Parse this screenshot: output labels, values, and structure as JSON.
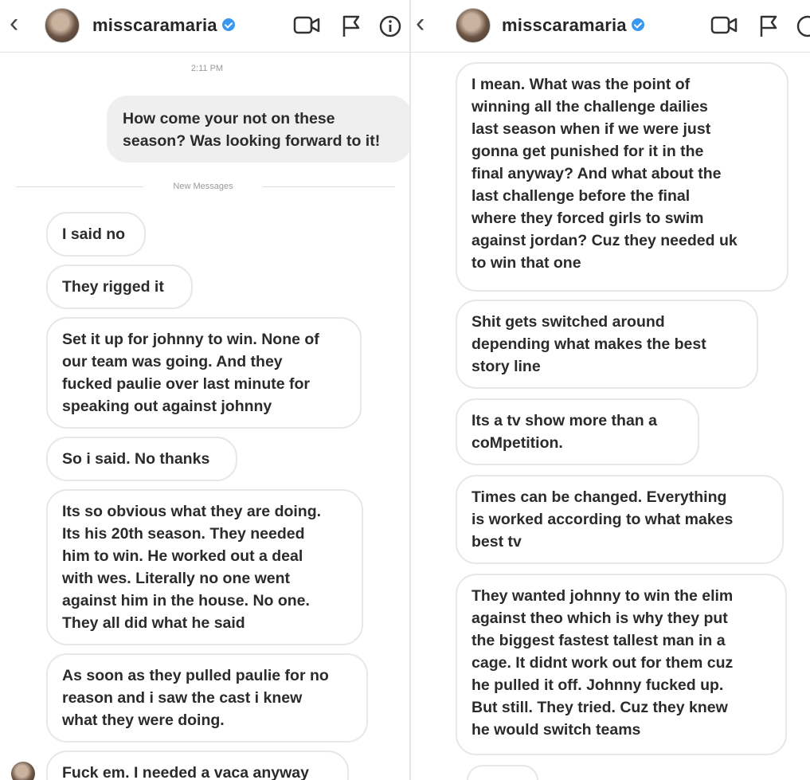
{
  "left": {
    "header": {
      "username": "misscaramaria"
    },
    "timestamp": "2:11 PM",
    "new_messages_label": "New Messages",
    "sent_message": "How come your not on these\nseason? Was looking forward to it!",
    "messages": [
      "I said no",
      "They rigged it",
      "Set it up for johnny to win. None of\nour team was going. And they\nfucked paulie over last minute for\nspeaking out against johnny",
      "So i said. No thanks",
      "Its so obvious what they are doing.\nIts his 20th season. They needed\nhim to win. He worked out a deal\nwith wes. Literally no one went\nagainst him in the house. No one.\nThey all did what he said",
      "As soon as they pulled paulie for no\nreason and i saw the cast i knew\nwhat they were doing.",
      "Fuck em. I needed a vaca anyway"
    ]
  },
  "right": {
    "header": {
      "username": "misscaramaria"
    },
    "messages": [
      "I mean. What was the point of\nwinning all the challenge dailies\nlast season when if we were just\ngonna get punished for it in the\nfinal anyway? And what about the\nlast challenge before the final\nwhere they forced girls to swim\nagainst jordan? Cuz they needed uk\nto win that one",
      "Shit gets switched around\ndepending what makes the best\nstory line",
      "Its a tv show more than a\ncoMpetition.",
      "Times can be changed. Everything\nis worked according to what makes\nbest tv",
      "They wanted johnny to win the elim\nagainst theo which is why they put\nthe biggest fastest tallest man in a\ncage. It didnt work out for them cuz\nhe pulled it off. Johnny fucked up.\nBut still. They tried. Cuz they knew\nhe would switch teams"
    ]
  }
}
